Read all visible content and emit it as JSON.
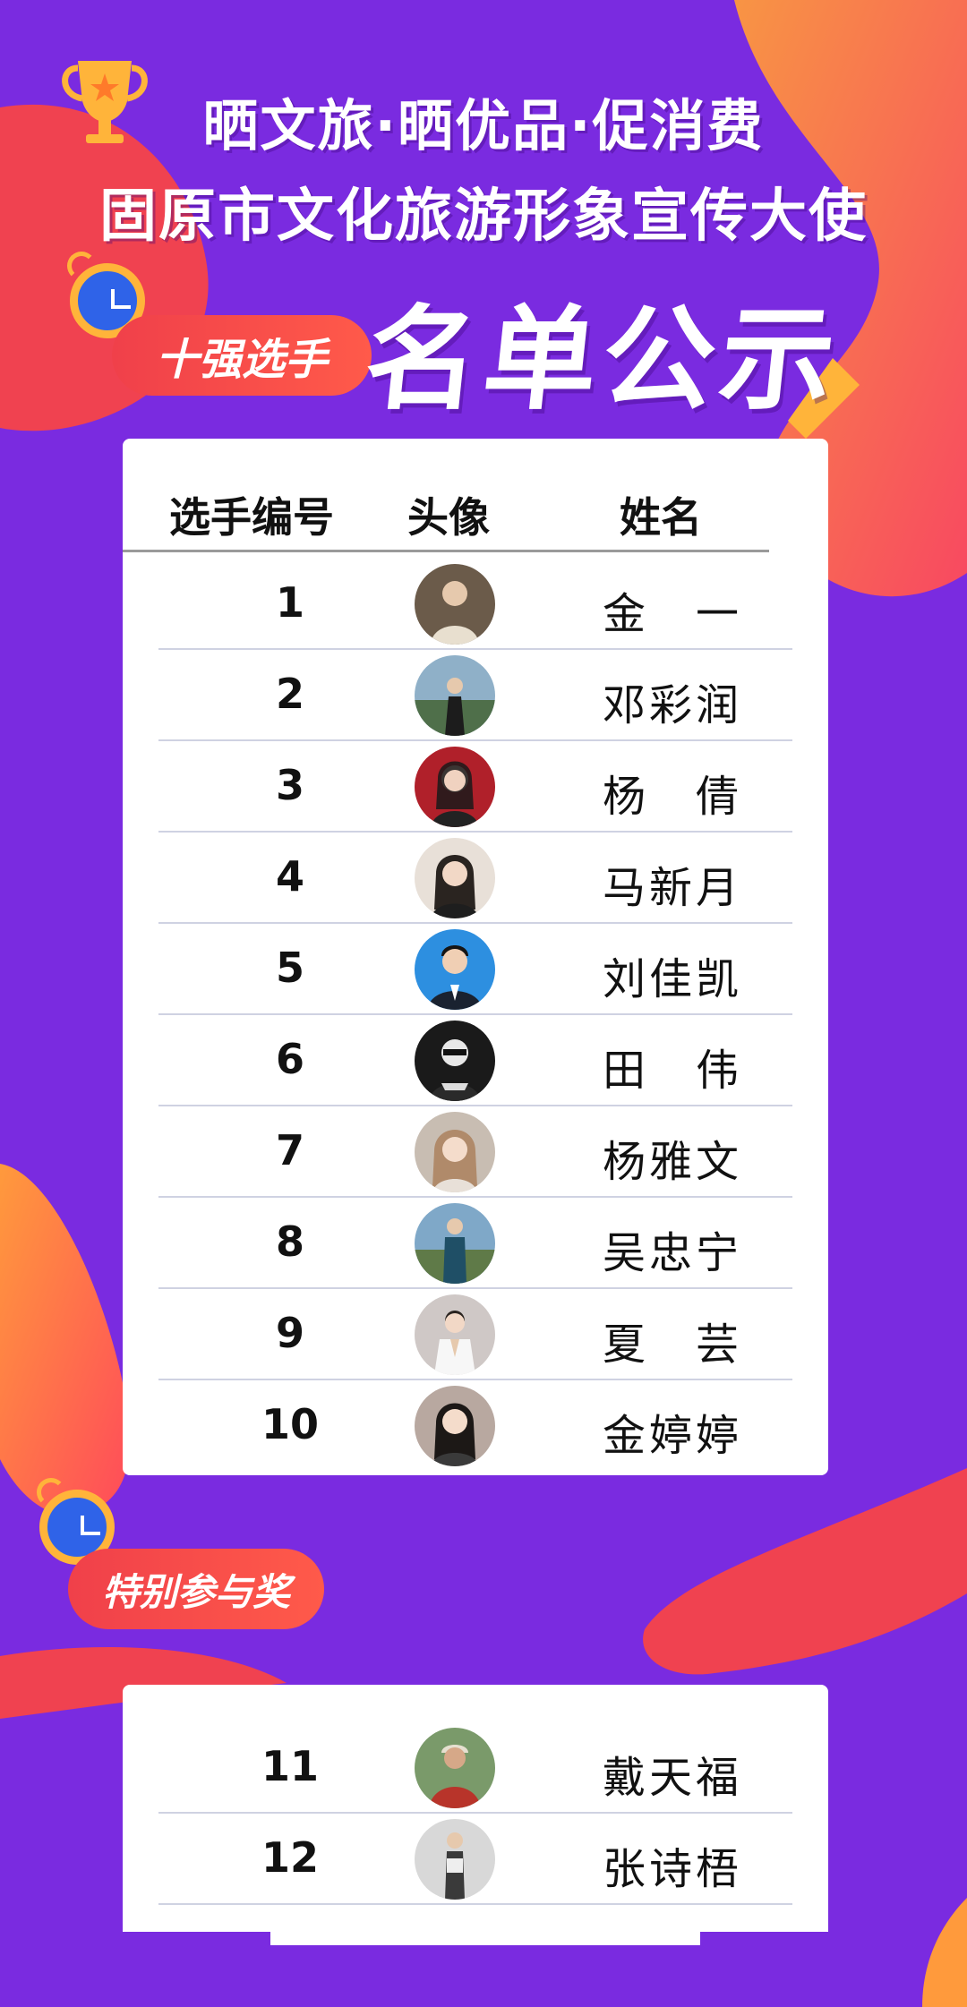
{
  "header": {
    "line1": "晒文旅·晒优品·促消费",
    "line2": "固原市文化旅游形象宣传大使",
    "big_title": "名单公示",
    "badge_top": "十强选手",
    "badge_bottom": "特别参与奖"
  },
  "table": {
    "columns": {
      "number": "选手编号",
      "avatar": "头像",
      "name": "姓名"
    },
    "rows": [
      {
        "number": "1",
        "name": "金　一",
        "avatar_color": "#6b5b4a"
      },
      {
        "number": "2",
        "name": "邓彩润",
        "avatar_color": "#4f6f8a"
      },
      {
        "number": "3",
        "name": "杨　倩",
        "avatar_color": "#b0202a"
      },
      {
        "number": "4",
        "name": "马新月",
        "avatar_color": "#d8c7b6"
      },
      {
        "number": "5",
        "name": "刘佳凯",
        "avatar_color": "#2d8fe0"
      },
      {
        "number": "6",
        "name": "田　伟",
        "avatar_color": "#1a1a1a"
      },
      {
        "number": "7",
        "name": "杨雅文",
        "avatar_color": "#b6a89a"
      },
      {
        "number": "8",
        "name": "吴忠宁",
        "avatar_color": "#2f6b8c"
      },
      {
        "number": "9",
        "name": "夏　芸",
        "avatar_color": "#c9c2be"
      },
      {
        "number": "10",
        "name": "金婷婷",
        "avatar_color": "#9c8a84"
      }
    ]
  },
  "special": {
    "rows": [
      {
        "number": "11",
        "name": "戴天福",
        "avatar_color": "#a6402f"
      },
      {
        "number": "12",
        "name": "张诗梧",
        "avatar_color": "#8a8a8a"
      }
    ]
  },
  "colors": {
    "background": "#7a2be0",
    "accent_red": "#f0404a",
    "accent_orange": "#ffa63a",
    "clock_blue": "#2f63e8"
  }
}
